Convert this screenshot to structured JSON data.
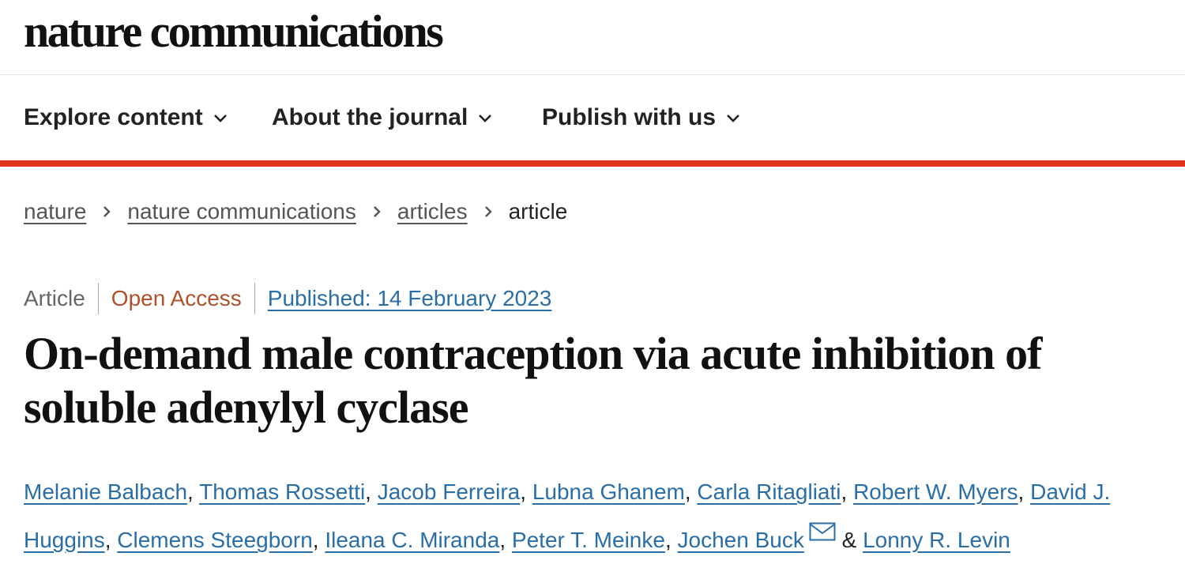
{
  "site": {
    "logo_text": "nature communications"
  },
  "nav": {
    "items": [
      {
        "label": "Explore content",
        "icon": "chevron-down-icon"
      },
      {
        "label": "About the journal",
        "icon": "chevron-down-icon"
      },
      {
        "label": "Publish with us",
        "icon": "chevron-down-icon"
      }
    ]
  },
  "breadcrumb": {
    "items": [
      {
        "label": "nature"
      },
      {
        "label": "nature communications"
      },
      {
        "label": "articles"
      },
      {
        "label": "article"
      }
    ]
  },
  "article": {
    "type": "Article",
    "access": "Open Access",
    "published": "Published: 14 February 2023",
    "title": "On-demand male contraception via acute inhibition of soluble adenylyl cyclase",
    "authors": [
      "Melanie Balbach",
      "Thomas Rossetti",
      "Jacob Ferreira",
      "Lubna Ghanem",
      "Carla Ritagliati",
      "Robert W. Myers",
      "David J. Huggins",
      "Clemens Steegborn",
      "Ileana C. Miranda",
      "Peter T. Meinke",
      "Jochen Buck",
      "Lonny R. Levin"
    ],
    "author_separator": ", ",
    "author_last_separator": " & ",
    "corresponding_icon": "mail-icon"
  },
  "colors": {
    "accent_bar": "#e0311f",
    "link": "#2a6ea6",
    "open_access": "#b0512c"
  }
}
